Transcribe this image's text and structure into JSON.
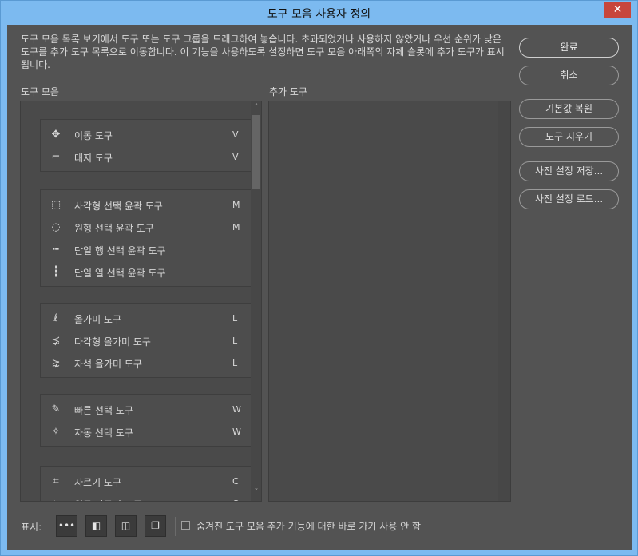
{
  "window": {
    "title": "도구 모음 사용자 정의",
    "close_glyph": "✕"
  },
  "description": "도구 모음 목록 보기에서 도구 또는 도구 그룹을 드래그하여 놓습니다. 초과되었거나 사용하지 않았거나 우선 순위가 낮은 도구를 추가 도구 목록으로 이동합니다. 이 기능을 사용하도록 설정하면 도구 모음 아래쪽의 자체 슬롯에 추가 도구가 표시됩니다.",
  "toolbar_list": {
    "label": "도구 모음",
    "scroll_up": "˄",
    "scroll_down": "˅",
    "groups": [
      {
        "tools": [
          {
            "name": "이동 도구",
            "key": "V",
            "icon": "move-icon",
            "glyph": "✥"
          },
          {
            "name": "대지 도구",
            "key": "V",
            "icon": "artboard-icon",
            "glyph": "⌐"
          }
        ]
      },
      {
        "tools": [
          {
            "name": "사각형 선택 윤곽 도구",
            "key": "M",
            "icon": "rect-marquee-icon",
            "glyph": "⬚"
          },
          {
            "name": "원형 선택 윤곽 도구",
            "key": "M",
            "icon": "ellipse-marquee-icon",
            "glyph": "◌"
          },
          {
            "name": "단일 행 선택 윤곽 도구",
            "key": "",
            "icon": "single-row-marquee-icon",
            "glyph": "┅"
          },
          {
            "name": "단일 열 선택 윤곽 도구",
            "key": "",
            "icon": "single-column-marquee-icon",
            "glyph": "┇"
          }
        ]
      },
      {
        "tools": [
          {
            "name": "올가미 도구",
            "key": "L",
            "icon": "lasso-icon",
            "glyph": "ℓ"
          },
          {
            "name": "다각형 올가미 도구",
            "key": "L",
            "icon": "polygonal-lasso-icon",
            "glyph": "⋨"
          },
          {
            "name": "자석 올가미 도구",
            "key": "L",
            "icon": "magnetic-lasso-icon",
            "glyph": "⋩"
          }
        ]
      },
      {
        "tools": [
          {
            "name": "빠른 선택 도구",
            "key": "W",
            "icon": "quick-selection-icon",
            "glyph": "✎"
          },
          {
            "name": "자동 선택 도구",
            "key": "W",
            "icon": "magic-wand-icon",
            "glyph": "✧"
          }
        ]
      },
      {
        "tools": [
          {
            "name": "자르기 도구",
            "key": "C",
            "icon": "crop-icon",
            "glyph": "⌗"
          },
          {
            "name": "원근 자르기 도구",
            "key": "C",
            "icon": "perspective-crop-icon",
            "glyph": "⌗"
          }
        ]
      }
    ]
  },
  "extra_tools": {
    "label": "추가 도구"
  },
  "buttons": {
    "ok": "완료",
    "cancel": "취소",
    "restore_defaults": "기본값 복원",
    "clear_tools": "도구 지우기",
    "save_preset": "사전 설정 저장...",
    "load_preset": "사전 설정 로드..."
  },
  "bottom": {
    "show_label": "표시:",
    "view_buttons": [
      {
        "icon": "more-icon",
        "glyph": "•••"
      },
      {
        "icon": "foreground-background-icon",
        "glyph": "◧"
      },
      {
        "icon": "quick-mask-icon",
        "glyph": "◫"
      },
      {
        "icon": "screen-mode-icon",
        "glyph": "❐"
      }
    ],
    "checkbox_label": "숨겨진 도구 모음 추가 기능에 대한 바로 가기 사용 안 함"
  },
  "colors": {
    "title_bar": "#7cbaf0",
    "panel_bg": "#535353",
    "close": "#c7463c"
  }
}
